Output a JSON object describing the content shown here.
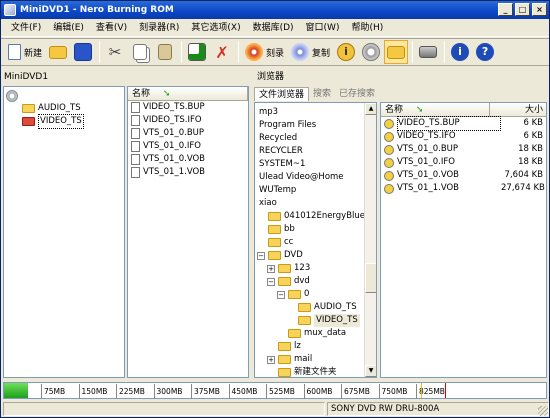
{
  "window": {
    "title": "MiniDVD1 - Nero Burning ROM"
  },
  "menu": [
    "文件(F)",
    "编辑(E)",
    "查看(V)",
    "刻录器(R)",
    "其它选项(X)",
    "数据库(D)",
    "窗口(W)",
    "帮助(H)"
  ],
  "toolbar": {
    "new_label": "新建",
    "burn_label": "刻录",
    "copy_label": "复制"
  },
  "left": {
    "title": "MiniDVD1",
    "tree": [
      "AUDIO_TS",
      "VIDEO_TS"
    ],
    "col_name": "名称",
    "files": [
      "VIDEO_TS.BUP",
      "VIDEO_TS.IFO",
      "VTS_01_0.BUP",
      "VTS_01_0.IFO",
      "VTS_01_0.VOB",
      "VTS_01_1.VOB"
    ]
  },
  "browser": {
    "title": "浏览器",
    "tabs": [
      "文件浏览器",
      "搜索",
      "已存搜索"
    ],
    "tree": [
      {
        "label": "mp3",
        "lvl": 0,
        "type": "text"
      },
      {
        "label": "Program Files",
        "lvl": 0,
        "type": "text"
      },
      {
        "label": "Recycled",
        "lvl": 0,
        "type": "text"
      },
      {
        "label": "RECYCLER",
        "lvl": 0,
        "type": "text"
      },
      {
        "label": "SYSTEM~1",
        "lvl": 0,
        "type": "text"
      },
      {
        "label": "Ulead Video@Home",
        "lvl": 0,
        "type": "text"
      },
      {
        "label": "WUTemp",
        "lvl": 0,
        "type": "text"
      },
      {
        "label": "xiao",
        "lvl": 0,
        "type": "text"
      },
      {
        "label": "041012EnergyBlue",
        "lvl": 0,
        "type": "folder"
      },
      {
        "label": "bb",
        "lvl": 0,
        "type": "folder"
      },
      {
        "label": "cc",
        "lvl": 0,
        "type": "folder"
      },
      {
        "label": "DVD",
        "lvl": 0,
        "type": "folder-exp"
      },
      {
        "label": "123",
        "lvl": 1,
        "type": "folder-plus"
      },
      {
        "label": "dvd",
        "lvl": 1,
        "type": "folder-exp"
      },
      {
        "label": "0",
        "lvl": 2,
        "type": "folder-exp"
      },
      {
        "label": "AUDIO_TS",
        "lvl": 3,
        "type": "folder"
      },
      {
        "label": "VIDEO_TS",
        "lvl": 3,
        "type": "folder-sel"
      },
      {
        "label": "mux_data",
        "lvl": 2,
        "type": "folder"
      },
      {
        "label": "lz",
        "lvl": 1,
        "type": "folder"
      },
      {
        "label": "mail",
        "lvl": 1,
        "type": "folder-plus"
      },
      {
        "label": "新建文件夹",
        "lvl": 1,
        "type": "folder"
      }
    ],
    "col_name": "名称",
    "col_size": "大小",
    "files": [
      {
        "name": "VIDEO_TS.BUP",
        "size": "6 KB"
      },
      {
        "name": "VIDEO_TS.IFO",
        "size": "6 KB"
      },
      {
        "name": "VTS_01_0.BUP",
        "size": "18 KB"
      },
      {
        "name": "VTS_01_0.IFO",
        "size": "18 KB"
      },
      {
        "name": "VTS_01_0.VOB",
        "size": "7,604 KB"
      },
      {
        "name": "VTS_01_1.VOB",
        "size": "27,674 KB"
      }
    ]
  },
  "capacity": {
    "ticks": [
      "75MB",
      "150MB",
      "225MB",
      "300MB",
      "375MB",
      "450MB",
      "525MB",
      "600MB",
      "675MB",
      "750MB",
      "825MB"
    ],
    "used_fraction": 0.045
  },
  "status": {
    "drive": "SONY     DVD RW DRU-800A"
  },
  "colors": {
    "title": "#0a46c8",
    "fill": "#1ca01c",
    "select": "#0a246a"
  }
}
